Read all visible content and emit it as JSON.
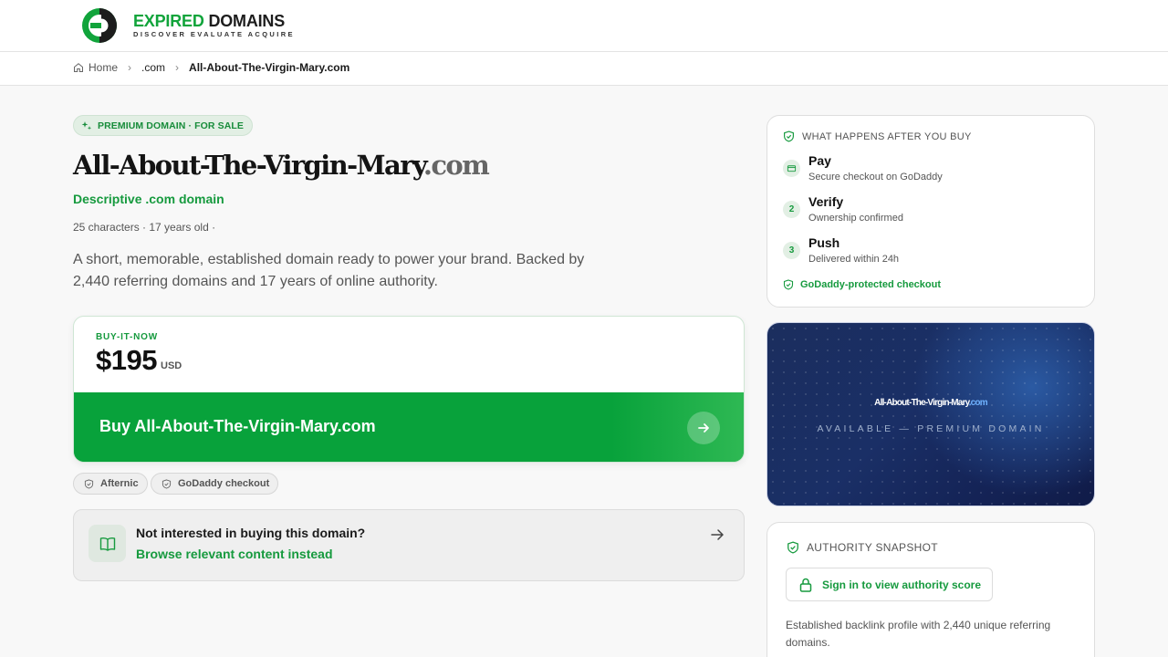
{
  "brand": {
    "name_part1": "EXPIRED",
    "name_part2": "DOMAINS",
    "tagline": "DISCOVER EVALUATE ACQUIRE",
    "accent_color": "#11a43b"
  },
  "breadcrumb": {
    "items": [
      "Home",
      ".com",
      "All-About-The-Virgin-Mary.com"
    ]
  },
  "hero": {
    "badge": "PREMIUM DOMAIN · FOR SALE",
    "domain_name": "All-About-The-Virgin-Mary",
    "domain_tld": ".com",
    "subtitle": "Descriptive .com domain",
    "meta": "25 characters · 17 years old ·",
    "description": "A short, memorable, established domain ready to power your brand. Backed by 2,440 referring domains and 17 years of online authority."
  },
  "buy": {
    "label": "BUY-IT-NOW",
    "price": "$195",
    "currency": "USD",
    "button_label": "Buy All-About-The-Virgin-Mary.com"
  },
  "chips": [
    "Afternic",
    "GoDaddy checkout"
  ],
  "alternative": {
    "title": "Not interested in buying this domain?",
    "link": "Browse relevant content instead"
  },
  "steps_card": {
    "heading": "WHAT HAPPENS AFTER YOU BUY",
    "steps": [
      {
        "num": "",
        "icon": "credit-card-icon",
        "title": "Pay",
        "desc": "Secure checkout on GoDaddy"
      },
      {
        "num": "2",
        "title": "Verify",
        "desc": "Ownership confirmed"
      },
      {
        "num": "3",
        "title": "Push",
        "desc": "Delivered within 24h"
      }
    ],
    "footer": "GoDaddy-protected checkout"
  },
  "preview": {
    "domain_name": "All-About-The-Virgin-Mary",
    "domain_tld": ".com",
    "tagline": "AVAILABLE — PREMIUM DOMAIN"
  },
  "authority": {
    "heading": "AUTHORITY SNAPSHOT",
    "signin_label": "Sign in to view authority score",
    "description": "Established backlink profile with 2,440 unique referring domains."
  }
}
